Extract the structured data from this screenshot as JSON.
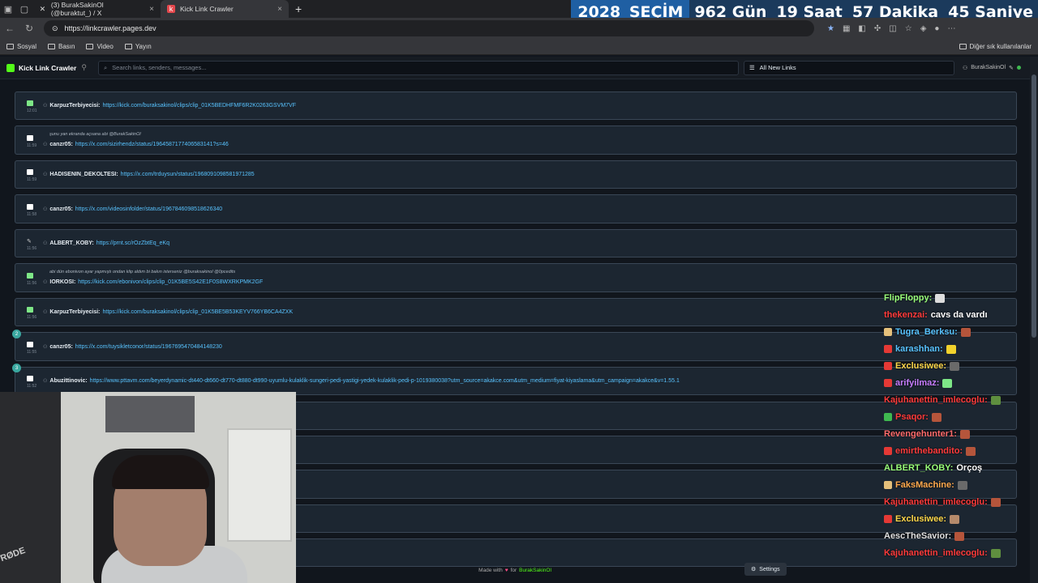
{
  "browser": {
    "tabs": [
      {
        "label": "(3) BurakSakinOl (@buraktut_) / X",
        "icon": "x-icon"
      },
      {
        "label": "Kick Link Crawler",
        "icon": "kick-icon"
      }
    ],
    "url": "https://linkcrawler.pages.dev",
    "bookmarks": [
      "Sosyal",
      "Basın",
      "Video",
      "Yayın"
    ],
    "other_bookmarks": "Diğer sık kullanılanlar"
  },
  "countdown": {
    "year": "2028",
    "label": "SEÇİM",
    "days": "962 Gün",
    "hours": "19 Saat",
    "minutes": "57 Dakika",
    "seconds": "45 Saniye"
  },
  "app": {
    "title": "Kick Link Crawler",
    "search_placeholder": "Search links, senders, messages...",
    "filter_label": "All New Links",
    "user": "BurakSakinOl"
  },
  "rows": [
    {
      "time": "12:01",
      "msg": "",
      "sender": "KarpuzTerbiyecisi:",
      "link": "https://kick.com/buraksakinol/clips/clip_01K5BEDHFMF6R2K0263GSVM7VF",
      "icon_color": "#7ee787"
    },
    {
      "time": "11:59",
      "msg": "şunu yan ekranda açsana abi @BurakSakinOl",
      "sender": "canzr05:",
      "link": "https://x.com/sizirhendz/status/1964587177406583141?s=46",
      "icon_color": "#ffffff"
    },
    {
      "time": "11:59",
      "msg": "",
      "sender": "HADISENIN_DEKOLTESI:",
      "link": "https://x.com/trduysun/status/1968091098581971285",
      "icon_color": "#ffffff"
    },
    {
      "time": "11:58",
      "msg": "",
      "sender": "canzr05:",
      "link": "https://x.com/videosinfolder/status/1967846098518626340",
      "icon_color": "#ffffff"
    },
    {
      "time": "11:56",
      "msg": "",
      "sender": "ALBERT_KOBY:",
      "link": "https://prnt.sc/rOzZbtEq_eKq",
      "icon_color": "#cccccc"
    },
    {
      "time": "11:56",
      "msg": "abi dün ebonivon ayar yapmıştı ondan klip aldım bi bakın isterseniz @buraksakinol @0pcedits",
      "sender": "IORKOSI:",
      "link": "https://kick.com/ebonivon/clips/clip_01K5BE5S42E1F0S8WXRKPMK2GF",
      "icon_color": "#7ee787"
    },
    {
      "time": "11:56",
      "msg": "",
      "sender": "KarpuzTerbiyecisi:",
      "link": "https://kick.com/buraksakinol/clips/clip_01K5BE5B53KEYV766YB6CA4ZXK",
      "icon_color": "#7ee787"
    },
    {
      "time": "11:55",
      "msg": "",
      "sender": "canzr05:",
      "link": "https://x.com/tuysikletconor/status/1967695470484148230",
      "icon_color": "#ffffff",
      "badge": "2"
    },
    {
      "time": "11:52",
      "msg": "",
      "sender": "Abuzittinovic:",
      "link": "https://www.pttavm.com/beyerdynamic-dt440-dt660-dt770-dt880-dt990-uyumlu-kulaklik-sungeri-pedi-yastigi-yedek-kulaklik-pedi-p-1019380038?utm_source=akakce.com&utm_medium=fiyat-kiyaslama&utm_campaign=akakce&v=1.55.1",
      "icon_color": "#ffffff",
      "badge": "3"
    }
  ],
  "chat": [
    {
      "user": "FlipFloppy:",
      "text": "",
      "color": "#9aff7a"
    },
    {
      "user": "thekenzai:",
      "text": "cavs da vardı",
      "color": "#ff3b3b"
    },
    {
      "user": "Tugra_Berksu:",
      "text": "",
      "color": "#58c3ff"
    },
    {
      "user": "karashhan:",
      "text": "",
      "color": "#58c3ff"
    },
    {
      "user": "Exclusiwee:",
      "text": "",
      "color": "#ffd84a"
    },
    {
      "user": "arifyilmaz:",
      "text": "",
      "color": "#c77dff"
    },
    {
      "user": "Kajuhanettin_imlecoglu:",
      "text": "",
      "color": "#ff3b3b"
    },
    {
      "user": "Psaqor:",
      "text": "",
      "color": "#ff3b3b"
    },
    {
      "user": "Revengehunter1:",
      "text": "",
      "color": "#ff6b6b"
    },
    {
      "user": "emirthebandito:",
      "text": "",
      "color": "#ff3b3b"
    },
    {
      "user": "ALBERT_KOBY:",
      "text": "Orçoş",
      "color": "#9aff7a"
    },
    {
      "user": "FaksMachine:",
      "text": "",
      "color": "#ffa94d"
    },
    {
      "user": "Kajuhanettin_imlecoglu:",
      "text": "",
      "color": "#ff3b3b"
    },
    {
      "user": "Exclusiwee:",
      "text": "",
      "color": "#ffd84a"
    },
    {
      "user": "AescTheSavior:",
      "text": "",
      "color": "#e0e0e0"
    },
    {
      "user": "Kajuhanettin_imlecoglu:",
      "text": "",
      "color": "#ff3b3b"
    }
  ],
  "footer": {
    "made_with": "Made with",
    "heart": "♥",
    "for": "for",
    "brand": "BurakSakinOl",
    "settings": "Settings"
  },
  "webcam": {
    "mic_brand": "RØDE"
  }
}
